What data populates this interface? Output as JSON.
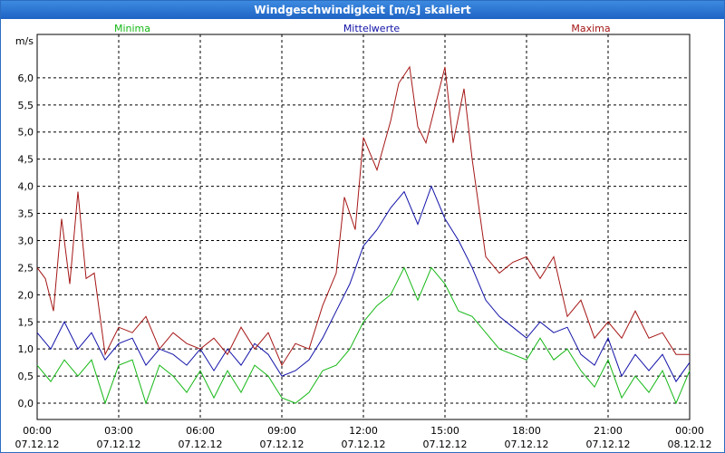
{
  "window": {
    "title": "Windgeschwindigkeit [m/s] skaliert"
  },
  "colors": {
    "minima": "#16b816",
    "mittelwerte": "#1212a8",
    "maxima": "#a51616",
    "grid": "#000000",
    "titlebar": "#2b6cc0"
  },
  "chart_data": {
    "type": "line",
    "title": "Windgeschwindigkeit [m/s] skaliert",
    "ylabel": "m/s",
    "xlabel": "",
    "ylim": [
      -0.3,
      6.8
    ],
    "yticks": [
      0.0,
      0.5,
      1.0,
      1.5,
      2.0,
      2.5,
      3.0,
      3.5,
      4.0,
      4.5,
      5.0,
      5.5,
      6.0
    ],
    "ytick_labels": [
      "0,0",
      "0,5",
      "1,0",
      "1,5",
      "2,0",
      "2,5",
      "3,0",
      "3,5",
      "4,0",
      "4,5",
      "5,0",
      "5,5",
      "6,0"
    ],
    "xlim": [
      0,
      24
    ],
    "xticks": [
      {
        "time": "00:00",
        "date": "07.12.12"
      },
      {
        "time": "03:00",
        "date": "07.12.12"
      },
      {
        "time": "06:00",
        "date": "07.12.12"
      },
      {
        "time": "09:00",
        "date": "07.12.12"
      },
      {
        "time": "12:00",
        "date": "07.12.12"
      },
      {
        "time": "15:00",
        "date": "07.12.12"
      },
      {
        "time": "18:00",
        "date": "07.12.12"
      },
      {
        "time": "21:00",
        "date": "07.12.12"
      },
      {
        "time": "00:00",
        "date": "08.12.12"
      }
    ],
    "grid": true,
    "legend_placement": "top",
    "series": [
      {
        "name": "Minima",
        "color": "#16b816",
        "x": [
          0,
          0.5,
          1,
          1.5,
          2,
          2.5,
          3,
          3.5,
          4,
          4.5,
          5,
          5.5,
          6,
          6.5,
          7,
          7.5,
          8,
          8.5,
          9,
          9.5,
          10,
          10.5,
          11,
          11.5,
          12,
          12.5,
          13,
          13.5,
          14,
          14.5,
          15,
          15.5,
          16,
          16.5,
          17,
          17.5,
          18,
          18.5,
          19,
          19.5,
          20,
          20.5,
          21,
          21.5,
          22,
          22.5,
          23,
          23.5,
          24
        ],
        "y": [
          0.7,
          0.4,
          0.8,
          0.5,
          0.8,
          0.0,
          0.7,
          0.8,
          0.0,
          0.7,
          0.5,
          0.2,
          0.6,
          0.1,
          0.6,
          0.2,
          0.7,
          0.5,
          0.1,
          0.0,
          0.2,
          0.6,
          0.7,
          1.0,
          1.5,
          1.8,
          2.0,
          2.5,
          1.9,
          2.5,
          2.2,
          1.7,
          1.6,
          1.3,
          1.0,
          0.9,
          0.8,
          1.2,
          0.8,
          1.0,
          0.6,
          0.3,
          0.8,
          0.1,
          0.5,
          0.2,
          0.6,
          0.0,
          0.6
        ]
      },
      {
        "name": "Mittelwerte",
        "color": "#1212a8",
        "x": [
          0,
          0.5,
          1,
          1.5,
          2,
          2.5,
          3,
          3.5,
          4,
          4.5,
          5,
          5.5,
          6,
          6.5,
          7,
          7.5,
          8,
          8.5,
          9,
          9.5,
          10,
          10.5,
          11,
          11.5,
          12,
          12.5,
          13,
          13.5,
          14,
          14.5,
          15,
          15.5,
          16,
          16.5,
          17,
          17.5,
          18,
          18.5,
          19,
          19.5,
          20,
          20.5,
          21,
          21.5,
          22,
          22.5,
          23,
          23.5,
          24
        ],
        "y": [
          1.3,
          1.0,
          1.5,
          1.0,
          1.3,
          0.8,
          1.1,
          1.2,
          0.7,
          1.0,
          0.9,
          0.7,
          1.0,
          0.6,
          1.0,
          0.7,
          1.1,
          0.9,
          0.5,
          0.6,
          0.8,
          1.2,
          1.7,
          2.2,
          2.9,
          3.2,
          3.6,
          3.9,
          3.3,
          4.0,
          3.4,
          3.0,
          2.5,
          1.9,
          1.6,
          1.4,
          1.2,
          1.5,
          1.3,
          1.4,
          0.9,
          0.7,
          1.2,
          0.5,
          0.9,
          0.6,
          0.9,
          0.4,
          0.75
        ]
      },
      {
        "name": "Maxima",
        "color": "#a51616",
        "x": [
          0,
          0.3,
          0.6,
          0.9,
          1.2,
          1.5,
          1.8,
          2.1,
          2.5,
          3,
          3.5,
          4,
          4.5,
          5,
          5.5,
          6,
          6.5,
          7,
          7.5,
          8,
          8.5,
          9,
          9.5,
          10,
          10.5,
          11,
          11.3,
          11.7,
          12,
          12.5,
          13,
          13.3,
          13.7,
          14,
          14.3,
          14.7,
          15,
          15.3,
          15.7,
          16,
          16.5,
          17,
          17.5,
          18,
          18.5,
          19,
          19.5,
          20,
          20.5,
          21,
          21.5,
          22,
          22.5,
          23,
          23.5,
          24
        ],
        "y": [
          2.5,
          2.3,
          1.7,
          3.4,
          2.2,
          3.9,
          2.3,
          2.4,
          0.9,
          1.4,
          1.3,
          1.6,
          1.0,
          1.3,
          1.1,
          1.0,
          1.2,
          0.9,
          1.4,
          1.0,
          1.3,
          0.7,
          1.1,
          1.0,
          1.8,
          2.4,
          3.8,
          3.2,
          4.9,
          4.3,
          5.2,
          5.9,
          6.2,
          5.1,
          4.8,
          5.6,
          6.2,
          4.8,
          5.8,
          4.5,
          2.7,
          2.4,
          2.6,
          2.7,
          2.3,
          2.7,
          1.6,
          1.9,
          1.2,
          1.5,
          1.2,
          1.7,
          1.2,
          1.3,
          0.9,
          0.9
        ]
      }
    ]
  }
}
